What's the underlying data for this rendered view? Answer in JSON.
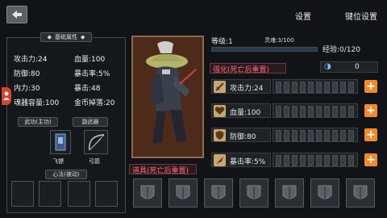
{
  "top": {
    "settings": "设置",
    "keybind": "键位设置"
  },
  "basic": {
    "title": "基础属性",
    "attack": "攻击力:24",
    "hp": "血量:100",
    "defense": "防御:80",
    "crit_rate": "暴击率:5%",
    "inner": "内力:30",
    "crit": "暴击:48",
    "soul": "魂器容量:100",
    "gold": "金币掉落:20"
  },
  "weapons": {
    "main_label": "武功(主功)",
    "sub_label": "副武器",
    "main_name": "飞镖",
    "sub_name": "弓箭",
    "heart_label": "心法(被动)"
  },
  "level": {
    "level": "等级:1",
    "soul_progress": "灵魂:3/100",
    "exp": "经验:0/120",
    "exp_fraction": 0
  },
  "enhance": {
    "title": "强化(死亡后重置)",
    "currency": "0",
    "rows": [
      {
        "label": "攻击力:24",
        "icon": "sword-icon"
      },
      {
        "label": "血量:100",
        "icon": "heart-icon"
      },
      {
        "label": "防御:80",
        "icon": "shield-icon"
      },
      {
        "label": "暴击率:5%",
        "icon": "crit-icon"
      }
    ]
  },
  "items": {
    "title": "道具(死亡后重置)"
  }
}
